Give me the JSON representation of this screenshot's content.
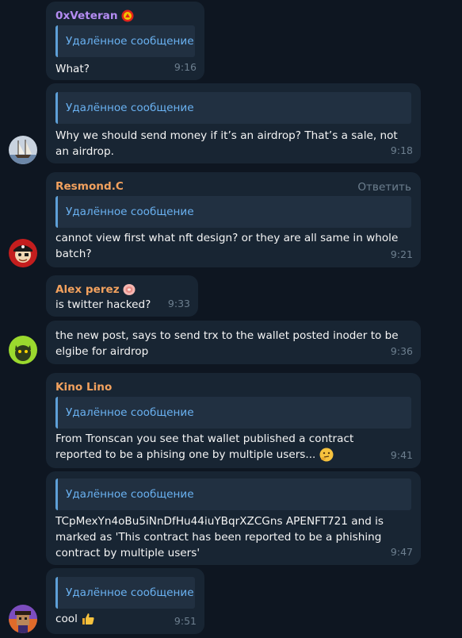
{
  "messages": [
    {
      "sender": "0xVeteran",
      "quote": "Удалённое сообщение",
      "text": "What?",
      "time": "9:16"
    },
    {
      "quote": "Удалённое сообщение",
      "text": "Why we should send money if it’s an airdrop? That’s a sale, not an airdrop.",
      "time": "9:18"
    },
    {
      "sender": "Resmond.C",
      "reply_action": "Ответить",
      "quote": "Удалённое сообщение",
      "text": "cannot view first what nft design? or they are all same in whole batch?",
      "time": "9:21"
    },
    {
      "sender": "Alex perez",
      "text": "is twitter hacked?",
      "time": "9:33"
    },
    {
      "text": "the new post, says to send trx to the wallet posted inoder to be elgibe for airdrop",
      "time": "9:36"
    },
    {
      "sender": "Kino Lino",
      "quote": "Удалённое сообщение",
      "text": "From Tronscan you see that wallet published a contract reported to be a phising one by multiple users...",
      "time": "9:41"
    },
    {
      "quote": "Удалённое сообщение",
      "text": "TCpMexYn4oBu5iNnDfHu44iuYBqrXZCGns APENFT721  and is marked as 'This contract has been reported to be a phishing contract by multiple users'",
      "time": "9:47"
    },
    {
      "quote": "Удалённое сообщение",
      "text": "cool",
      "time": "9:51"
    }
  ],
  "colors": {
    "background": "#0e1621",
    "bubble": "#182533",
    "quote_bg": "#213041",
    "link_blue": "#6ab2f2",
    "name_purple": "#b48cf2",
    "name_orange": "#f2a15e"
  }
}
